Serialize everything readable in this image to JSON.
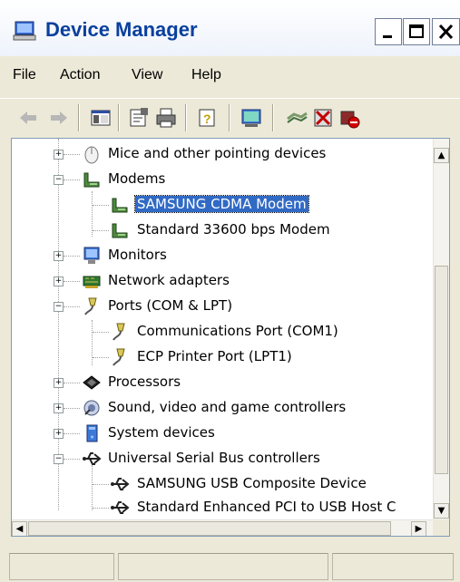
{
  "window": {
    "title": "Device Manager",
    "title_icon": "device-manager-computer-icon"
  },
  "title_buttons": {
    "minimize_icon": "minimize-icon",
    "maximize_icon": "maximize-icon",
    "close_icon": "close-icon"
  },
  "menu": {
    "items": [
      "File",
      "Action",
      "View",
      "Help"
    ]
  },
  "toolbar": {
    "buttons": [
      "back",
      "forward",
      "show-hide-console-tree",
      "properties",
      "print",
      "help",
      "scan-for-hardware-changes",
      "update-driver",
      "disable-device",
      "uninstall-device"
    ]
  },
  "tree": {
    "items": [
      {
        "label": "Mice and other pointing devices",
        "icon": "mouse-icon",
        "level": 1,
        "expander": "+"
      },
      {
        "label": "Modems",
        "icon": "modem-icon",
        "level": 1,
        "expander": "−"
      },
      {
        "label": "SAMSUNG CDMA Modem",
        "icon": "modem-icon",
        "level": 2,
        "selected": true
      },
      {
        "label": "Standard 33600 bps Modem",
        "icon": "modem-icon",
        "level": 2
      },
      {
        "label": "Monitors",
        "icon": "monitor-icon",
        "level": 1,
        "expander": "+"
      },
      {
        "label": "Network adapters",
        "icon": "network-adapter-icon",
        "level": 1,
        "expander": "+"
      },
      {
        "label": "Ports (COM & LPT)",
        "icon": "port-icon",
        "level": 1,
        "expander": "−"
      },
      {
        "label": "Communications Port (COM1)",
        "icon": "port-icon",
        "level": 2
      },
      {
        "label": "ECP Printer Port (LPT1)",
        "icon": "port-icon",
        "level": 2
      },
      {
        "label": "Processors",
        "icon": "processor-icon",
        "level": 1,
        "expander": "+"
      },
      {
        "label": "Sound, video and game controllers",
        "icon": "sound-icon",
        "level": 1,
        "expander": "+"
      },
      {
        "label": "System devices",
        "icon": "system-device-icon",
        "level": 1,
        "expander": "+"
      },
      {
        "label": "Universal Serial Bus controllers",
        "icon": "usb-icon",
        "level": 1,
        "expander": "−"
      },
      {
        "label": "SAMSUNG USB Composite Device",
        "icon": "usb-icon",
        "level": 2
      },
      {
        "label": "Standard Enhanced PCI to USB Host C",
        "icon": "usb-icon",
        "level": 2
      }
    ]
  },
  "scrollbars": {
    "up_arrow": "▲",
    "down_arrow": "▼",
    "left_arrow": "◀",
    "right_arrow": "▶"
  },
  "colors": {
    "title_text": "#0a3f9e",
    "selection": "#316ac5",
    "chrome": "#ece9d8"
  }
}
